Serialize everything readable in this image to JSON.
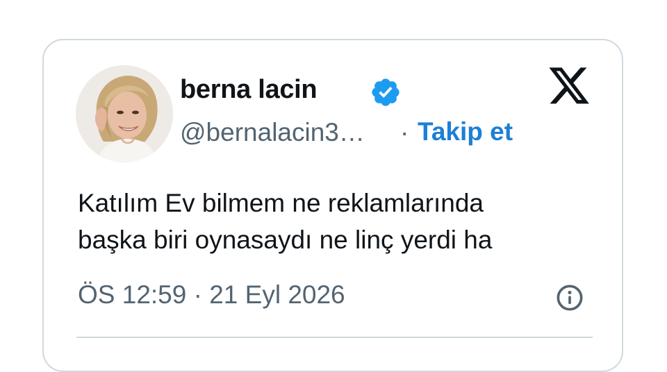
{
  "author": {
    "display_name": "berna lacin",
    "handle": "@bernalacin3…",
    "verified_icon": "verified-badge-icon"
  },
  "actions": {
    "separator": "·",
    "follow_label": "Takip et"
  },
  "brand": {
    "logo_icon": "x-logo-icon"
  },
  "tweet": {
    "lines": [
      "Katılım Ev bilmem ne reklamlarında",
      "başka biri oynasaydı ne linç yerdi ha"
    ],
    "timestamp": "ÖS 12:59 · 21 Eyl 2026",
    "info_icon": "info-icon"
  },
  "colors": {
    "accent": "#1d7fd6",
    "verified": "#1d9bf0",
    "text_primary": "#0f1419",
    "text_secondary": "#536471",
    "border": "#cfd9de"
  }
}
